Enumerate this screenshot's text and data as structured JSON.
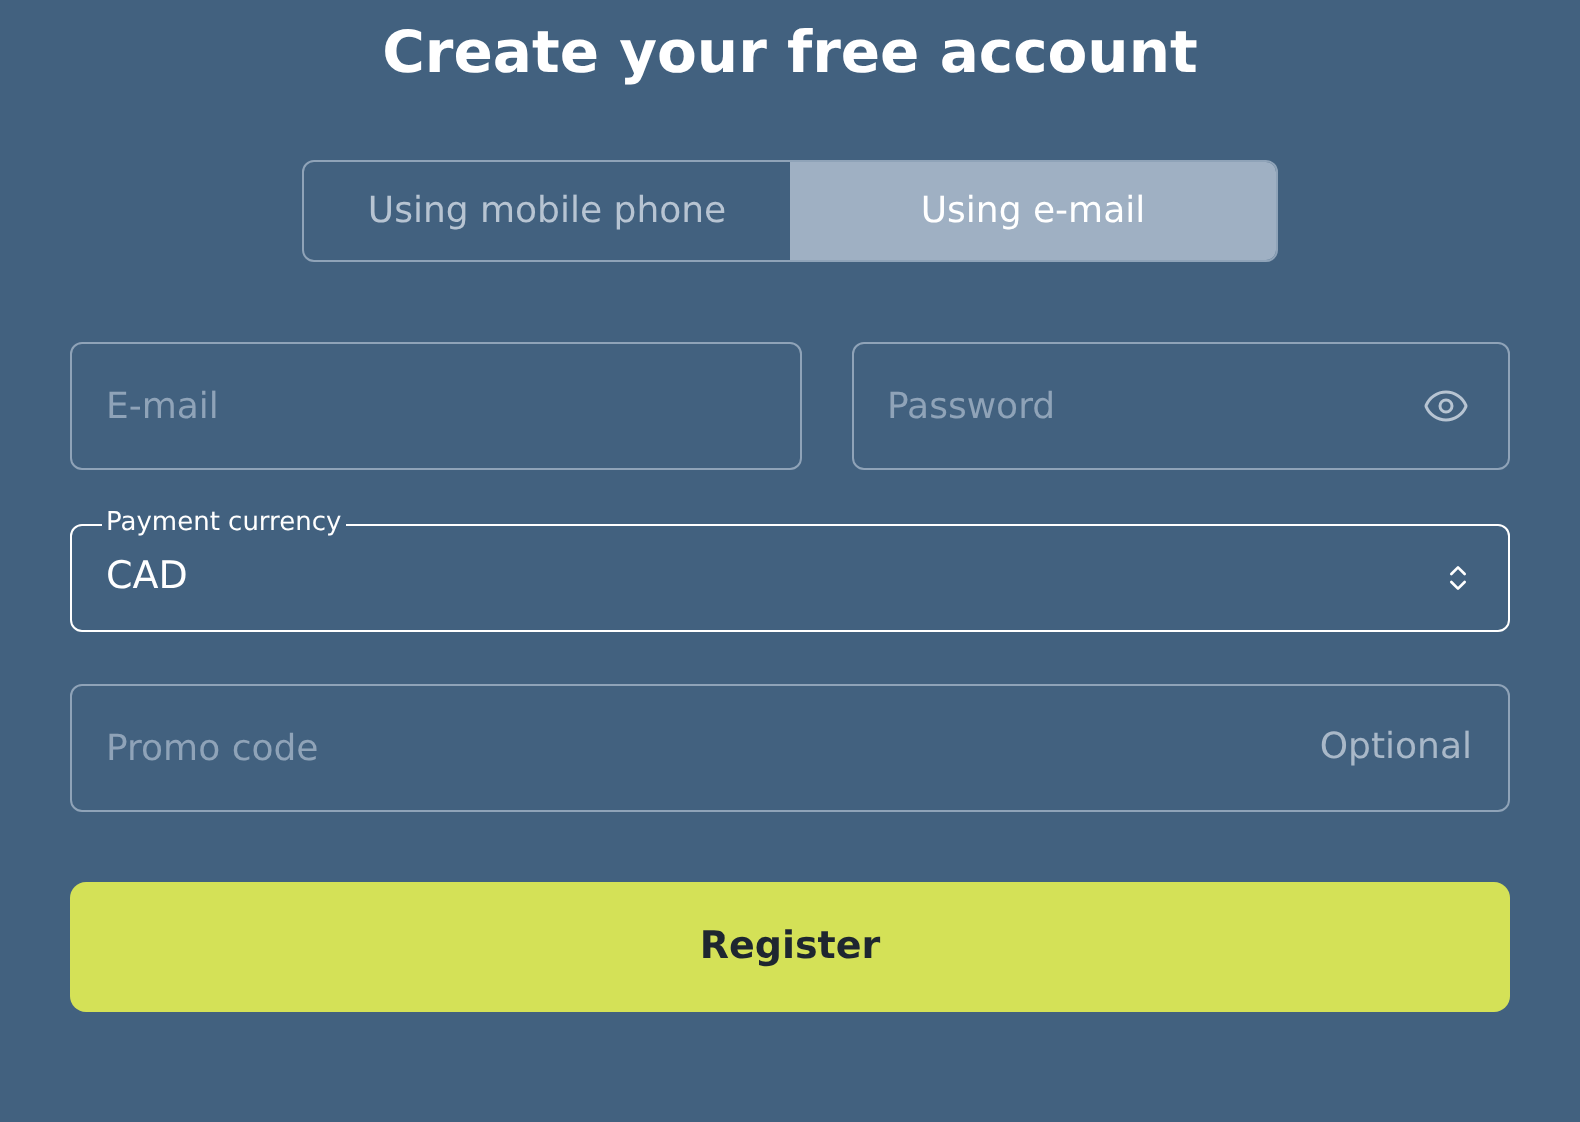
{
  "title": "Create your free account",
  "tabs": [
    {
      "label": "Using mobile phone",
      "selected": false
    },
    {
      "label": "Using e-mail",
      "selected": true
    }
  ],
  "email": {
    "placeholder": "E-mail"
  },
  "password": {
    "placeholder": "Password"
  },
  "currency": {
    "label": "Payment currency",
    "value": "CAD"
  },
  "promo": {
    "placeholder": "Promo code",
    "hint": "Optional"
  },
  "register_button": "Register"
}
